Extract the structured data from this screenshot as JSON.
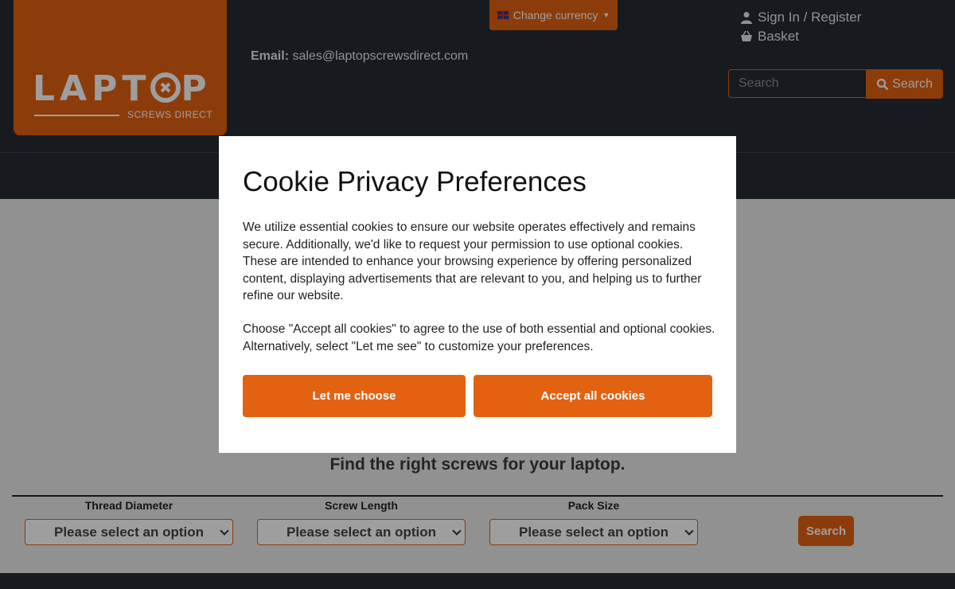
{
  "header": {
    "logo": {
      "name": "LAPTOP",
      "letters_left": "LAPT",
      "letters_right": "P",
      "sub": "SCREWS DIRECT"
    },
    "currency_label": "Change currency",
    "email_label": "Email:",
    "email_value": "sales@laptopscrewsdirect.com",
    "signin_label": "Sign In / Register",
    "basket_label": "Basket",
    "search_placeholder": "Search",
    "search_button": "Search"
  },
  "main": {
    "tagline": "Find the right screws for your laptop.",
    "filters": [
      {
        "label": "Thread Diameter",
        "value": "Please select an option"
      },
      {
        "label": "Screw Length",
        "value": "Please select an option"
      },
      {
        "label": "Pack Size",
        "value": "Please select an option"
      }
    ],
    "filter_button": "Search"
  },
  "modal": {
    "title": "Cookie Privacy Preferences",
    "paragraph1": "We utilize essential cookies to ensure our website operates effectively and remains secure. Additionally, we'd like to request your permission to use optional cookies. These are intended to enhance your browsing experience by offering personalized content, displaying advertisements that are relevant to you, and helping us to further refine our website.",
    "paragraph2": "Choose \"Accept all cookies\" to agree to the use of both essential and optional cookies. Alternatively, select \"Let me see\" to customize your preferences.",
    "choose_button": "Let me choose",
    "accept_button": "Accept all cookies"
  },
  "colors": {
    "accent": "#e36211",
    "header_bg": "#262a33"
  },
  "icons": [
    "flag-icon",
    "caret-down-icon",
    "user-icon",
    "basket-icon",
    "search-icon",
    "chevron-down-icon"
  ]
}
